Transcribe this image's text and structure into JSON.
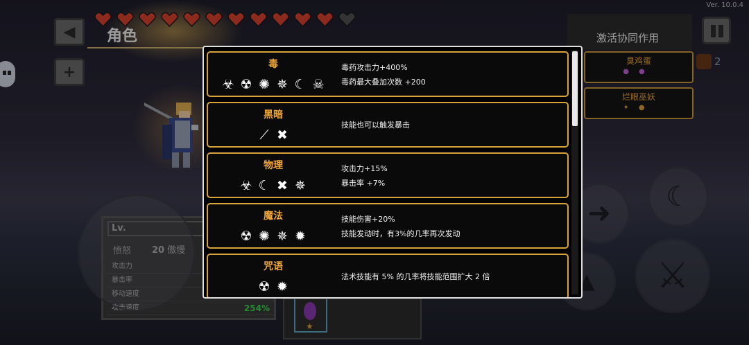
{
  "version": "Ver. 10.0.4",
  "header": {
    "title": "角色",
    "synergy_title": "激活协同作用"
  },
  "hearts": {
    "full": 11,
    "empty": 1,
    "full_color": "#d9412f",
    "empty_color": "#505050"
  },
  "stats": {
    "lv_label": "Lv.",
    "rage_label": "愤怒",
    "rage_value": "20",
    "rage_suffix": "傲慢",
    "rows": [
      {
        "label": "攻击力",
        "value": ""
      },
      {
        "label": "暴击率",
        "value": ""
      },
      {
        "label": "移动速度",
        "value": ""
      },
      {
        "label": "攻击速度",
        "value": "254%"
      }
    ]
  },
  "synergy_cards": [
    {
      "title": "臭鸡蛋"
    },
    {
      "title": "烂眼巫妖"
    }
  ],
  "demon_count": "2",
  "synergy_list": [
    {
      "name": "毒",
      "icons": [
        "☣",
        "☢",
        "✺",
        "✵",
        "☾",
        "☠"
      ],
      "lines": [
        "毒药攻击力+400%",
        "毒药最大叠加次数 +200"
      ]
    },
    {
      "name": "黑暗",
      "icons": [
        "⟋",
        "✖"
      ],
      "lines": [
        "技能也可以触发暴击"
      ]
    },
    {
      "name": "物理",
      "icons": [
        "☣",
        "☾",
        "✖",
        "✵"
      ],
      "lines": [
        "攻击力+15%",
        "暴击率 +7%"
      ]
    },
    {
      "name": "魔法",
      "icons": [
        "☢",
        "✺",
        "✵",
        "✹"
      ],
      "lines": [
        "技能伤害+20%",
        "技能发动时，有3%的几率再次发动"
      ]
    },
    {
      "name": "咒语",
      "icons": [
        "☢",
        "✹"
      ],
      "lines": [
        "法术技能有 5% 的几率将技能范围扩大 2 倍"
      ]
    }
  ],
  "colors": {
    "accent_gold": "#f0a63a",
    "card_border": "#d9a23b",
    "stat_green": "#38d84a",
    "gem_purple": "#8a3ab0"
  }
}
